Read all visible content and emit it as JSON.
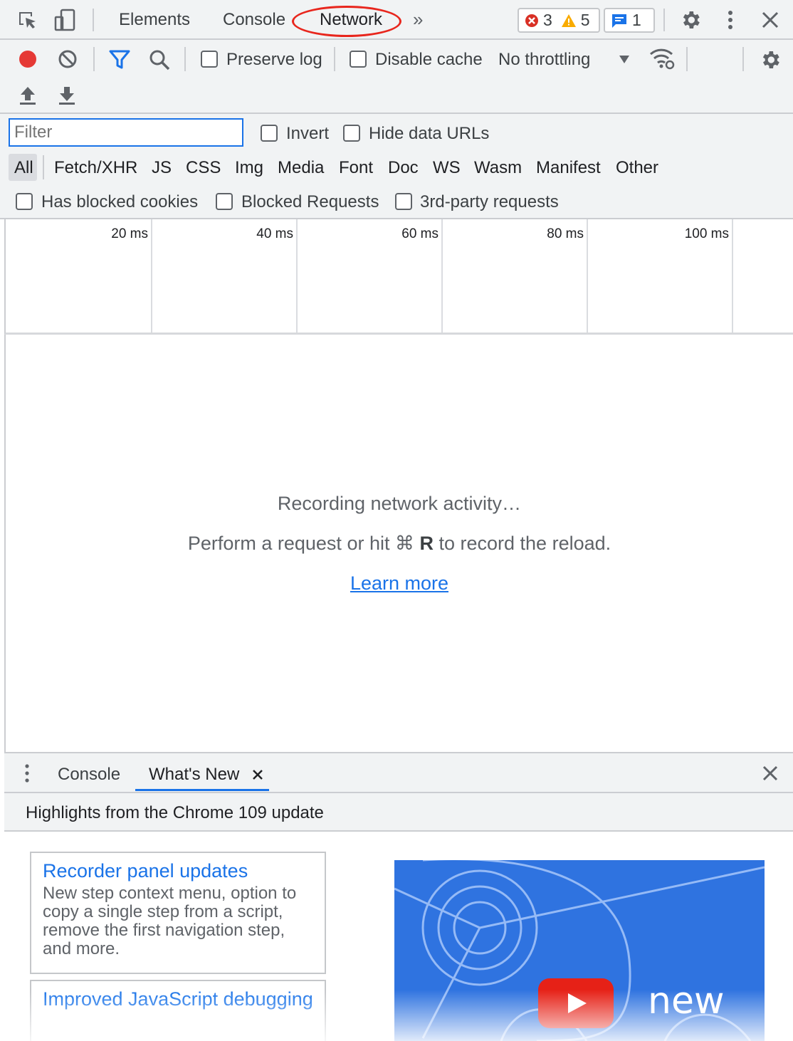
{
  "tabs": {
    "elements": "Elements",
    "console": "Console",
    "network": "Network",
    "more": "»"
  },
  "badges": {
    "errors": "3",
    "warnings": "5",
    "messages": "1"
  },
  "toolbar": {
    "preserve_log": "Preserve log",
    "disable_cache": "Disable cache",
    "throttling": "No throttling"
  },
  "filter": {
    "placeholder": "Filter",
    "invert": "Invert",
    "hide_data_urls": "Hide data URLs",
    "types": [
      "All",
      "Fetch/XHR",
      "JS",
      "CSS",
      "Img",
      "Media",
      "Font",
      "Doc",
      "WS",
      "Wasm",
      "Manifest",
      "Other"
    ],
    "has_blocked_cookies": "Has blocked cookies",
    "blocked_requests": "Blocked Requests",
    "third_party": "3rd-party requests"
  },
  "timeline": {
    "ticks": [
      "20 ms",
      "40 ms",
      "60 ms",
      "80 ms",
      "100 ms"
    ]
  },
  "empty": {
    "recording": "Recording network activity…",
    "perform_prefix": "Perform a request or hit ",
    "cmd_symbol": "⌘",
    "key": "R",
    "perform_suffix": " to record the reload.",
    "learn_more": "Learn more"
  },
  "drawer": {
    "tabs": {
      "console": "Console",
      "whats_new": "What's New"
    },
    "highlights": "Highlights from the Chrome 109 update",
    "cards": [
      {
        "title": "Recorder panel updates",
        "description": "New step context menu, option to copy a single step from a script, remove the first navigation step, and more."
      },
      {
        "title": "Improved JavaScript debugging",
        "description": ""
      }
    ],
    "video_text": "new"
  },
  "colors": {
    "accent": "#1a73e8",
    "record": "#e53935",
    "error": "#d93025",
    "warning": "#f9ab00",
    "annotation": "#e8261d"
  },
  "icons": [
    "select-element-icon",
    "device-toggle-icon",
    "settings-icon",
    "kebab-menu-icon",
    "close-icon",
    "record-icon",
    "clear-icon",
    "filter-icon",
    "search-icon",
    "network-conditions-icon",
    "import-har-icon",
    "export-har-icon",
    "play-icon"
  ]
}
